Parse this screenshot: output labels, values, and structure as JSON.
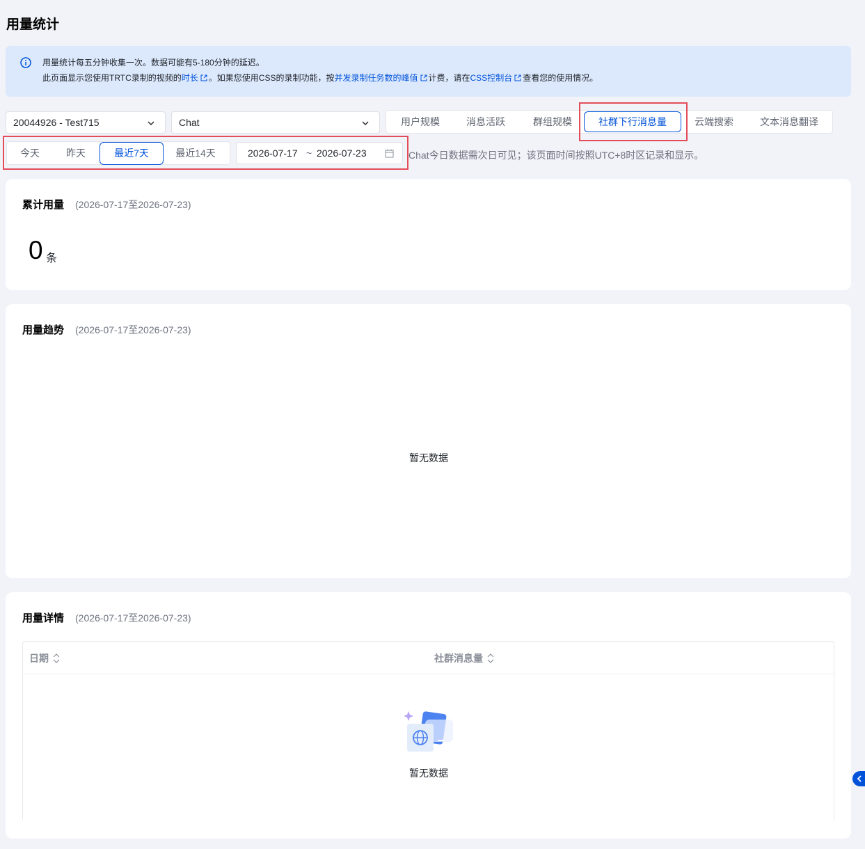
{
  "page": {
    "title": "用量统计"
  },
  "notice": {
    "line1": "用量统计每五分钟收集一次。数据可能有5-180分钟的延迟。",
    "line2_a": "此页面显示您使用TRTC录制的视频的",
    "line2_link1": "时长",
    "line2_b": "。如果您使用CSS的录制功能，按",
    "line2_link2": "并发录制任务数的峰值",
    "line2_c": "计费，请在",
    "line2_link3": "CSS控制台",
    "line2_d": "查看您的使用情况。"
  },
  "filters": {
    "app_select": "20044926 - Test715",
    "product_select": "Chat"
  },
  "tabs": [
    {
      "label": "用户规模"
    },
    {
      "label": "消息活跃"
    },
    {
      "label": "群组规模"
    },
    {
      "label": "社群下行消息量",
      "active": true
    },
    {
      "label": "云端搜索"
    },
    {
      "label": "文本消息翻译"
    }
  ],
  "range_tabs": [
    {
      "label": "今天"
    },
    {
      "label": "昨天"
    },
    {
      "label": "最近7天",
      "active": true
    },
    {
      "label": "最近14天"
    }
  ],
  "date_range": {
    "start": "2026-07-17",
    "separator": "~",
    "end": "2026-07-23"
  },
  "timezone_note": "Chat今日数据需次日可见；该页面时间按照UTC+8时区记录和显示。",
  "total_card": {
    "title": "累计用量",
    "range": "(2026-07-17至2026-07-23)",
    "value": "0",
    "unit": "条"
  },
  "trend_card": {
    "title": "用量趋势",
    "range": "(2026-07-17至2026-07-23)",
    "empty": "暂无数据"
  },
  "detail_card": {
    "title": "用量详情",
    "range": "(2026-07-17至2026-07-23)",
    "columns": [
      "日期",
      "社群消息量"
    ],
    "empty": "暂无数据"
  },
  "colors": {
    "accent": "#0052d9",
    "highlight_box": "#e34d59",
    "notice_bg": "#dce9fd",
    "page_bg": "#f2f3f8"
  }
}
